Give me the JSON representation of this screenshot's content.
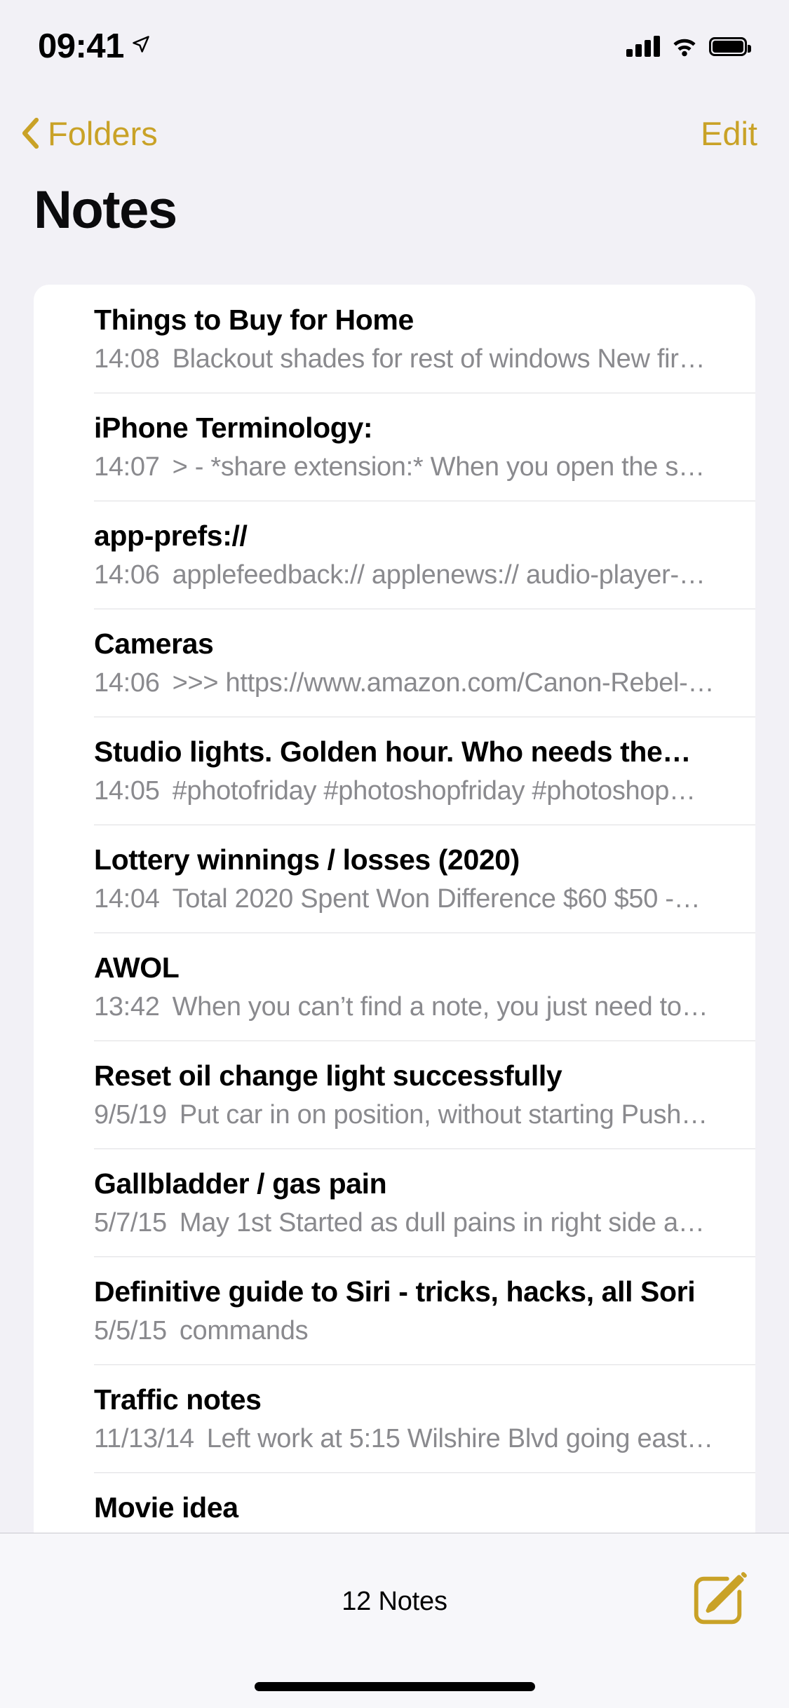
{
  "status_bar": {
    "time": "09:41",
    "location_icon": "location-arrow-icon",
    "cellular_icon": "cellular-bars-icon",
    "wifi_icon": "wifi-icon",
    "battery_icon": "battery-full-icon"
  },
  "nav": {
    "back_label": "Folders",
    "back_icon": "chevron-left-icon",
    "edit_label": "Edit"
  },
  "header": {
    "title": "Notes"
  },
  "colors": {
    "accent": "#C9A227",
    "page_background": "#F2F1F6",
    "card_background": "#FFFFFF",
    "title_text": "#000000",
    "secondary_text": "#8A8A8E",
    "separator": "#DEDEE1"
  },
  "notes": [
    {
      "title": "Things to Buy for Home",
      "date": "14:08",
      "snippet": "Blackout shades for rest of windows New fir…"
    },
    {
      "title": "iPhone Terminology:",
      "date": "14:07",
      "snippet": "> - *share extension:* When you open the sh…"
    },
    {
      "title": "app-prefs://",
      "date": "14:06",
      "snippet": "applefeedback:// applenews:// audio-player-…"
    },
    {
      "title": "Cameras",
      "date": "14:06",
      "snippet": ">>> https://www.amazon.com/Canon-Rebel-…"
    },
    {
      "title": "Studio lights. Golden hour. Who needs the…",
      "date": "14:05",
      "snippet": "#photofriday #photoshopfriday #photoshop…"
    },
    {
      "title": "Lottery winnings / losses (2020)",
      "date": "14:04",
      "snippet": "Total 2020 Spent Won Difference $60 $50 -…"
    },
    {
      "title": "AWOL",
      "date": "13:42",
      "snippet": "When you can’t find a note, you just need to…"
    },
    {
      "title": "Reset oil change light successfully",
      "date": "9/5/19",
      "snippet": "Put car in on position, without starting Push…"
    },
    {
      "title": "Gallbladder / gas pain",
      "date": "5/7/15",
      "snippet": "May 1st Started as dull pains in right side a…"
    },
    {
      "title": "Definitive guide to Siri - tricks, hacks, all Sori",
      "date": "5/5/15",
      "snippet": "commands"
    },
    {
      "title": "Traffic notes",
      "date": "11/13/14",
      "snippet": "Left work at 5:15 Wilshire Blvd going east…"
    },
    {
      "title": "Movie idea",
      "date": "",
      "snippet": ""
    }
  ],
  "toolbar": {
    "count_label": "12 Notes",
    "compose_icon": "compose-note-icon"
  }
}
